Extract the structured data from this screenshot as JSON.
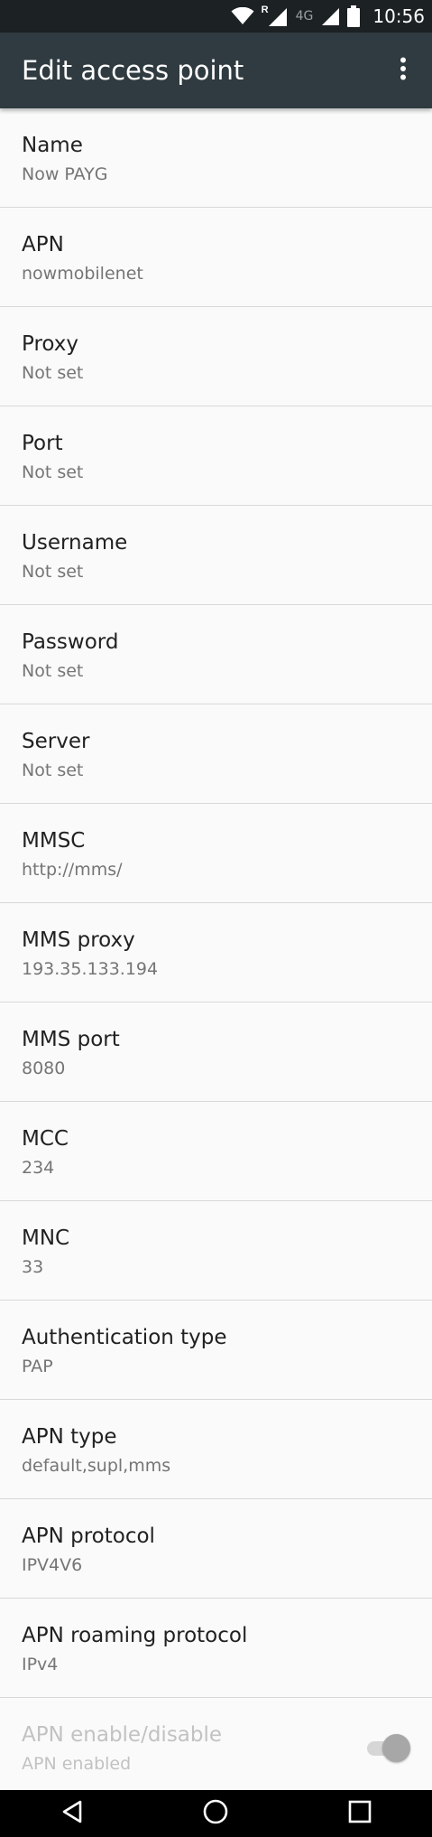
{
  "status_bar": {
    "signal_roaming_label": "R",
    "network_label": "4G",
    "time": "10:56",
    "icons": [
      "wifi-icon",
      "roaming-signal-icon",
      "network-4g-label",
      "cell-signal-icon",
      "battery-icon"
    ]
  },
  "app_bar": {
    "title": "Edit access point",
    "overflow_icon": "more-vert-icon"
  },
  "preferences": [
    {
      "title": "Name",
      "summary": "Now PAYG"
    },
    {
      "title": "APN",
      "summary": "nowmobilenet"
    },
    {
      "title": "Proxy",
      "summary": "Not set"
    },
    {
      "title": "Port",
      "summary": "Not set"
    },
    {
      "title": "Username",
      "summary": "Not set"
    },
    {
      "title": "Password",
      "summary": "Not set"
    },
    {
      "title": "Server",
      "summary": "Not set"
    },
    {
      "title": "MMSC",
      "summary": "http://mms/"
    },
    {
      "title": "MMS proxy",
      "summary": "193.35.133.194"
    },
    {
      "title": "MMS port",
      "summary": "8080"
    },
    {
      "title": "MCC",
      "summary": "234"
    },
    {
      "title": "MNC",
      "summary": "33"
    },
    {
      "title": "Authentication type",
      "summary": "PAP"
    },
    {
      "title": "APN type",
      "summary": "default,supl,mms"
    },
    {
      "title": "APN protocol",
      "summary": "IPV4V6"
    },
    {
      "title": "APN roaming protocol",
      "summary": "IPv4"
    },
    {
      "title": "APN enable/disable",
      "summary": "APN enabled",
      "toggle_on": true,
      "disabled": true
    }
  ],
  "nav_bar": {
    "buttons": [
      "back-icon",
      "home-icon",
      "recents-icon"
    ]
  },
  "colors": {
    "status_bar_bg": "#1c2124",
    "app_bar_bg": "#2f3b40",
    "list_bg": "#fafafa",
    "divider": "#d8d8d8",
    "title_text": "#212121",
    "summary_text": "#757575"
  }
}
